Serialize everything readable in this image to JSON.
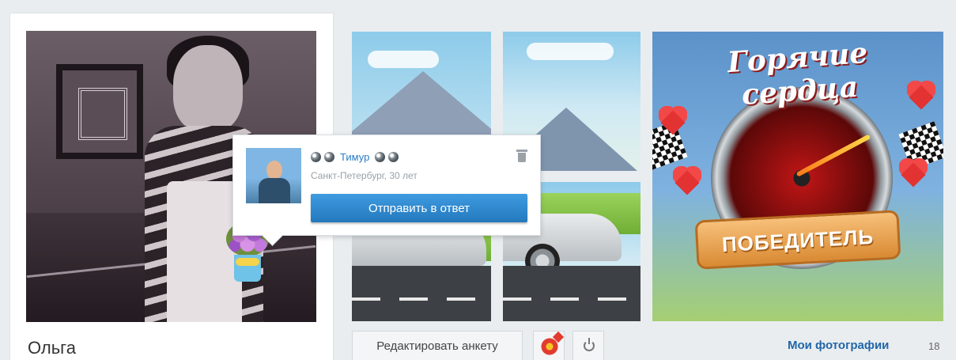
{
  "profile": {
    "name": "Ольга"
  },
  "popup": {
    "sender_name": "Тимур",
    "sender_info": "Санкт-Петербург, 30 лет",
    "reply_label": "Отправить в ответ"
  },
  "photos": {
    "banner_title": "Горячие сердца",
    "banner_ribbon": "ПОБЕДИТЕЛЬ",
    "link_label": "Мои фотографии",
    "count": "18"
  },
  "actions": {
    "edit_label": "Редактировать анкету"
  },
  "icons": {
    "gift": "flower-bouquet-icon",
    "rank": "gem-icon",
    "delete": "trash-icon",
    "flower": "flower-icon",
    "power": "power-icon"
  },
  "colors": {
    "accent_blue": "#2a7cc7",
    "button_blue": "#2479bd",
    "link_blue": "#2266a8",
    "muted_text": "#9aa1a7"
  }
}
